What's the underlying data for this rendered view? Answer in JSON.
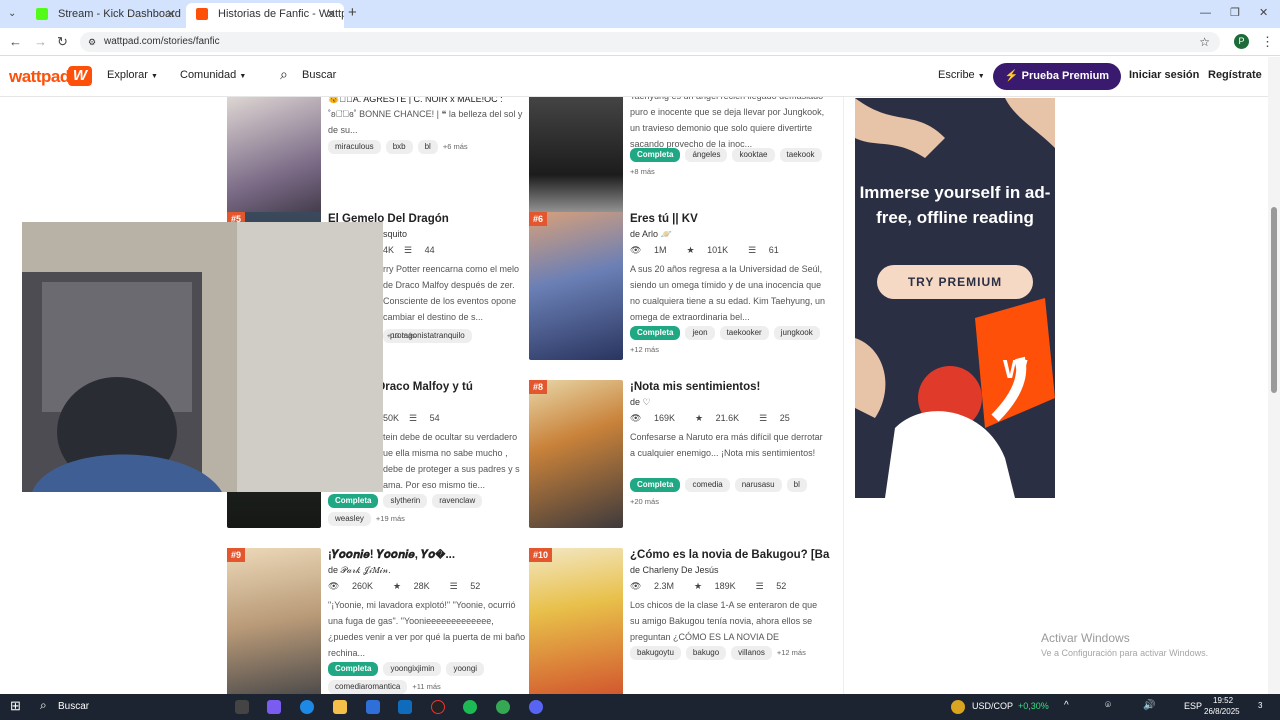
{
  "browser": {
    "tabs": [
      {
        "label": "Stream - Kick Dashboard",
        "active": false,
        "icon": "kick-icon",
        "color": "#53fc18"
      },
      {
        "label": "Historias de Fanfic - Wattpad",
        "active": true,
        "icon": "wattpad-icon",
        "color": "#ff500a"
      }
    ],
    "new_tab": "+",
    "url": "wattpad.com/stories/fanfic",
    "profile_initial": "P"
  },
  "nav": {
    "logo": "wattpad",
    "explore": "Explorar",
    "community": "Comunidad",
    "search": "Buscar",
    "write": "Escribe",
    "premium": "Prueba Premium",
    "login": "Iniciar sesión",
    "register": "Regístrate"
  },
  "stories": [
    {
      "rank": "",
      "title": "😽◡̈⃝A. AGRESTE | C. NOIR x MALE!OC :",
      "author": "",
      "stats": [],
      "description": "˚ʚ◡̈⃝ɞ˚ BONNE CHANCE! | ❝ la belleza del sol y de su...",
      "tags": [
        "miraculous",
        "bxb",
        "bl"
      ],
      "complete": false,
      "more": "+6 más"
    },
    {
      "rank": "",
      "title": "",
      "author": "",
      "stats": [],
      "description": "Taehyung es un ángel recién llegado demasiado puro e inocente que se deja llevar por Jungkook, un travieso demonio que solo quiere divertirte sacando provecho de la inoc...",
      "tags": [
        "ángeles",
        "kooktae",
        "taekook"
      ],
      "complete": true,
      "more": "+8 más"
    },
    {
      "rank": "#5",
      "title": "El Gemelo Del Dragón",
      "author": "squito",
      "stats": [
        "4K",
        "44"
      ],
      "description": "rry Potter reencarna como el melo de Draco Malfoy después de zer. Consciente de los eventos opone cambiar el destino de s...",
      "tags": [
        "protagonistatranquilo"
      ],
      "complete": false,
      "more": "+13 más"
    },
    {
      "rank": "#6",
      "title": "Eres tú || KV",
      "author": "de Arlo 🪐",
      "stats": [
        "1M",
        "101K",
        "61"
      ],
      "description": "A sus 20 años regresa a la Universidad de Seúl, siendo un omega tímido y de una inocencia que no cualquiera tiene a su edad. Kim Taehyung, un omega de extraordinaria bel...",
      "tags": [
        "jeon",
        "taekooker",
        "jungkook"
      ],
      "complete": true,
      "more": "+12 más"
    },
    {
      "rank": "",
      "title": "Draco Malfoy y tú",
      "author": "",
      "stats": [
        "50K",
        "54"
      ],
      "description": "tein debe de ocultar su verdadero ue ella misma no sabe mucho , debe de proteger a sus padres y s ama. Por eso mismo tie...",
      "tags": [
        "slytherin",
        "ravenclaw",
        "weasley"
      ],
      "complete": true,
      "more": "+19 más"
    },
    {
      "rank": "#8",
      "title": "¡Nota mis sentimientos!",
      "author": "de ♡",
      "stats": [
        "169K",
        "21.6K",
        "25"
      ],
      "description": "Confesarse a Naruto era más difícil que derrotar a cualquier enemigo... ¡Nota mis sentimientos!",
      "tags": [
        "comedia",
        "narusasu",
        "bl"
      ],
      "complete": true,
      "more": "+20 más"
    },
    {
      "rank": "#9",
      "title": "¡𝒀𝒐𝒐𝒏𝒊𝒆! 𝒀𝒐𝒐𝒏𝒊𝒆, 𝒀𝒐�...",
      "author": "de 𝒫𝒶𝓇𝓀 𝒥𝒾𝑀𝒾𝓃.",
      "stats": [
        "260K",
        "28K",
        "52"
      ],
      "description": "\"¡Yoonie, mi lavadora explotó!\" \"Yoonie, ocurrió una fuga de gas\". \"Yoonieeeeeeeeeeeee, ¿puedes venir a ver por qué la puerta de mi baño rechina...",
      "tags": [
        "yoongixjimin",
        "yoongi",
        "comediaromantica"
      ],
      "complete": true,
      "more": "+11 más"
    },
    {
      "rank": "#10",
      "title": "¿Cómo es la novia de Bakugou? [Bak...",
      "author": "de Charleny De Jesús",
      "stats": [
        "2.3M",
        "189K",
        "52"
      ],
      "description": "Los chicos de la clase 1-A se enteraron de que su amigo Bakugou tenía novia, ahora ellos se preguntan ¿CÓMO ES LA NOVIA DE BAKUGOU?",
      "tags": [
        "bakugoytu",
        "bakugo",
        "villanos"
      ],
      "complete": false,
      "more": "+12 más"
    }
  ],
  "complete_label": "Completa",
  "ad": {
    "headline": "Immerse yourself in ad-free, offline reading",
    "button": "TRY PREMIUM"
  },
  "windows": {
    "activate_title": "Activar Windows",
    "activate_sub": "Ve a Configuración para activar Windows.",
    "search": "Buscar",
    "ticker": "USD/COP",
    "ticker_change": "+0,30%",
    "lang": "ESP",
    "time": "19:52",
    "date": "26/8/2025",
    "notif": "3"
  }
}
